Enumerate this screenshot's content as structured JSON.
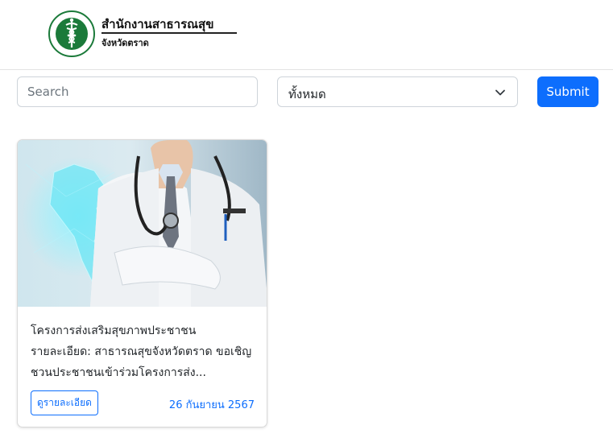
{
  "header": {
    "org_name": "สำนักงานสาธารณสุข",
    "org_sub": "จังหวัดตราด",
    "logo_icon": "moph-seal-icon"
  },
  "filters": {
    "search_placeholder": "Search",
    "category_selected": "ทั้งหมด",
    "submit_label": "Submit"
  },
  "colors": {
    "primary": "#0d6efd",
    "logo_green": "#1b7a3a"
  },
  "cards": [
    {
      "title": "โครงการส่งเสริมสุขภาพประชาชน",
      "description": "รายละเอียด: สาธารณสุขจังหวัดตราด ขอเชิญชวนประชาชนเข้าร่วมโครงการส่ง...",
      "detail_label": "ดูรายละเอียด",
      "date": "26 กันยายน 2567",
      "image_icon": "doctor-photo"
    }
  ]
}
